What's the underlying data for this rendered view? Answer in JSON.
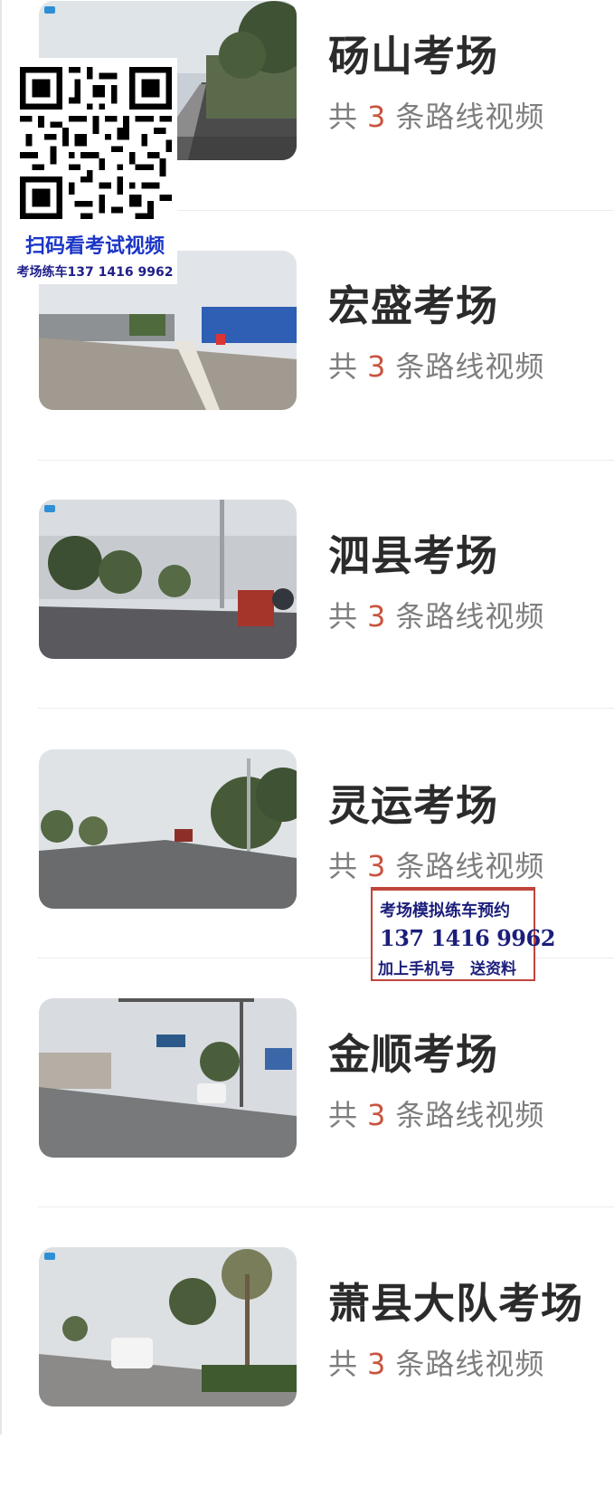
{
  "venues": [
    {
      "name": "砀山考场",
      "prefix": "共",
      "count": "3",
      "suffix": "条路线视频"
    },
    {
      "name": "宏盛考场",
      "prefix": "共",
      "count": "3",
      "suffix": "条路线视频"
    },
    {
      "name": "泗县考场",
      "prefix": "共",
      "count": "3",
      "suffix": "条路线视频"
    },
    {
      "name": "灵运考场",
      "prefix": "共",
      "count": "3",
      "suffix": "条路线视频"
    },
    {
      "name": "金顺考场",
      "prefix": "共",
      "count": "3",
      "suffix": "条路线视频"
    },
    {
      "name": "萧县大队考场",
      "prefix": "共",
      "count": "3",
      "suffix": "条路线视频"
    }
  ],
  "qr_overlay": {
    "title": "扫码看考试视频",
    "phone": "考场练车137 1416 9962"
  },
  "promo": {
    "line1": "考场模拟练车预约",
    "line2": "137 1416 9962",
    "line3": "加上手机号　送资料"
  },
  "colors": {
    "title": "#2b2b2b",
    "subtitle": "#7e7e7e",
    "count_accent": "#c8543f",
    "qr_title": "#1a35c7",
    "promo_text": "#1b1e7a",
    "promo_border": "#c0453a"
  }
}
